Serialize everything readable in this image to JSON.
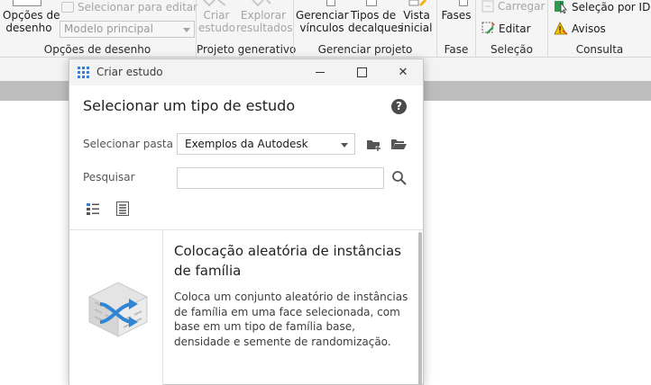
{
  "ribbon": {
    "groups": {
      "drawing_options": {
        "label": "Opções de desenho",
        "big_button": {
          "line1": "Opções de",
          "line2": "desenho"
        },
        "select_edit": "Selecionar para editar",
        "model_combo": "Modelo principal"
      },
      "generative": {
        "label": "Projeto generativo",
        "create_study": {
          "line1": "Criar",
          "line2": "estudo"
        },
        "explore_results": {
          "line1": "Explorar",
          "line2": "resultados"
        }
      },
      "manage": {
        "label": "Gerenciar projeto",
        "manage_links": {
          "line1": "Gerenciar",
          "line2": "vínculos"
        },
        "decal_types": {
          "line1": "Tipos de",
          "line2": "decalques"
        },
        "start_view": {
          "line1": "Vista",
          "line2": "inicial"
        }
      },
      "phase": {
        "label": "Fase",
        "phases": "Fases"
      },
      "selection": {
        "label": "Seleção",
        "load": "Carregar",
        "edit": "Editar"
      },
      "inquiry": {
        "label": "Consulta",
        "select_by_id": "Seleção  por ID",
        "warnings": "Avisos"
      }
    }
  },
  "dialog": {
    "title": "Criar estudo",
    "heading": "Selecionar um tipo de estudo",
    "help_symbol": "?",
    "folder_label": "Selecionar pasta",
    "folder_value": "Exemplos da Autodesk",
    "search_label": "Pesquisar",
    "search_value": "",
    "close_symbol": "✕",
    "study": {
      "title": "Colocação aleatória de instâncias de família",
      "description": "Coloca um conjunto aleatório de instâncias de família em uma face selecionada, com base em um tipo de família base, densidade e semente de randomização."
    }
  },
  "colors": {
    "accent": "#3a7fd0",
    "icon_blue": "#2f86d6",
    "folder_yellow": "#f2b01e",
    "warning_yellow": "#f5c200",
    "green_icon": "#2e9b4f"
  }
}
